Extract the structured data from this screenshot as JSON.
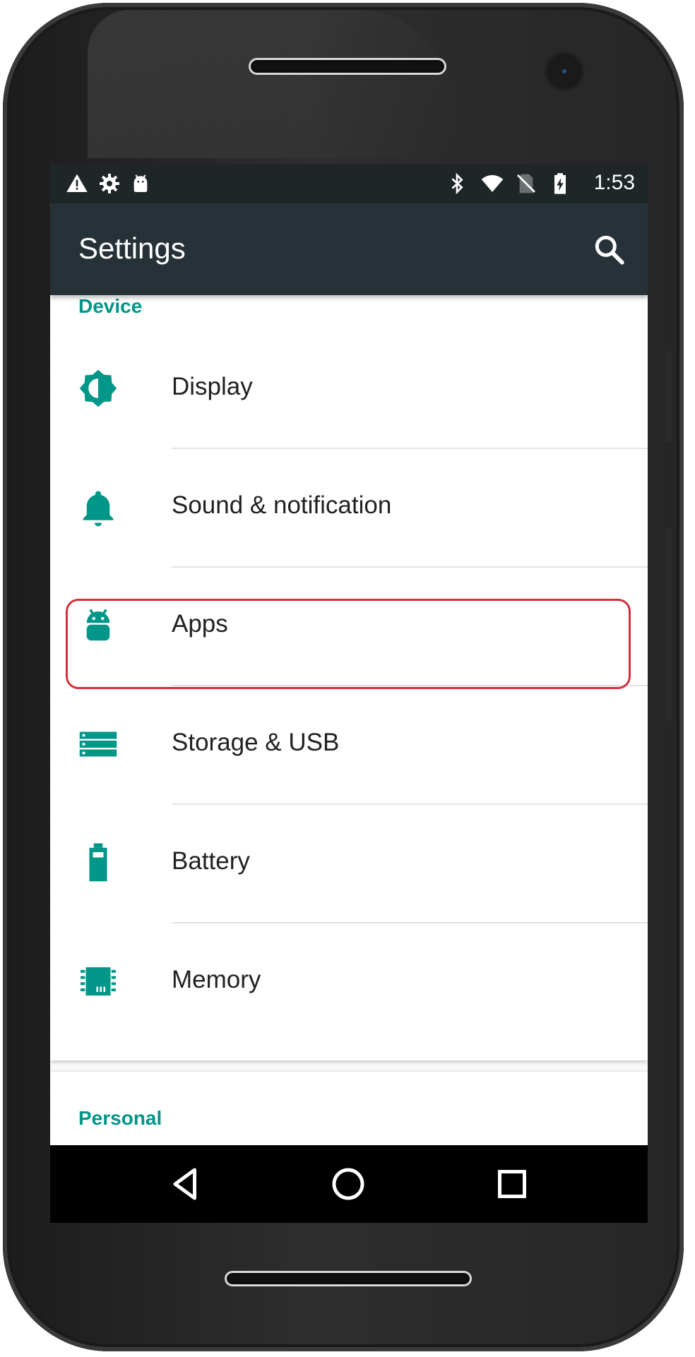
{
  "status_bar": {
    "time": "1:53",
    "left_icons": [
      "warning-icon",
      "gear-icon",
      "android-icon"
    ],
    "right_icons": [
      "bluetooth-icon",
      "wifi-icon",
      "no-sim-icon",
      "battery-charging-icon"
    ]
  },
  "app_bar": {
    "title": "Settings",
    "search_icon": "search-icon"
  },
  "sections": {
    "device": {
      "header": "Device",
      "items": [
        {
          "label": "Display",
          "icon": "brightness-icon"
        },
        {
          "label": "Sound & notification",
          "icon": "bell-icon"
        },
        {
          "label": "Apps",
          "icon": "android-icon"
        },
        {
          "label": "Storage & USB",
          "icon": "storage-icon"
        },
        {
          "label": "Battery",
          "icon": "battery-icon"
        },
        {
          "label": "Memory",
          "icon": "memory-chip-icon"
        }
      ]
    },
    "personal": {
      "header": "Personal"
    }
  },
  "highlight": {
    "target": "Apps",
    "color": "#d32f3a"
  },
  "colors": {
    "accent": "#009688",
    "app_bar": "#263238",
    "status_bar": "#1f2628",
    "nav_bar": "#000000"
  },
  "nav_bar": {
    "buttons": [
      "back-icon",
      "home-icon",
      "recents-icon"
    ]
  }
}
